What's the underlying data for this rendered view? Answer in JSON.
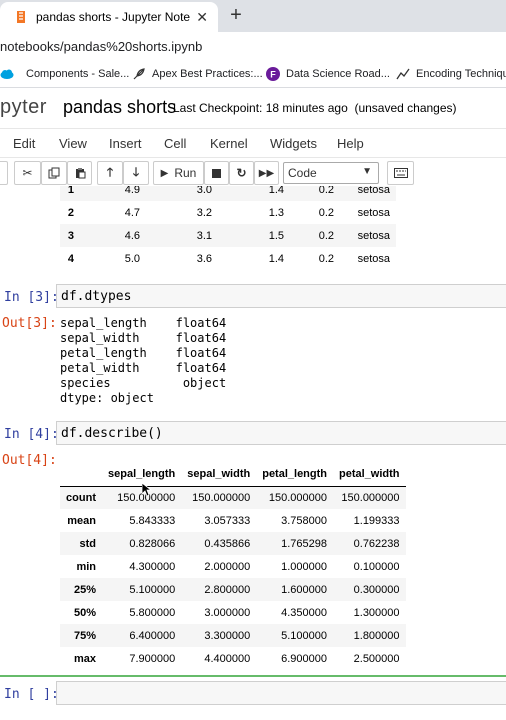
{
  "browser": {
    "tab_title": "pandas shorts - Jupyter Notebook",
    "address": "notebooks/pandas%20shorts.ipynb",
    "bookmarks": [
      {
        "label": "Components - Sale...",
        "icon": "salesforce-cloud-icon",
        "color": "#00a1e0"
      },
      {
        "label": "Apex Best Practices:...",
        "icon": "feather-icon",
        "color": "#333333"
      },
      {
        "label": "Data Science Road...",
        "icon": "circle-f-icon",
        "color": "#6a1b9a"
      },
      {
        "label": "Encoding Technique",
        "icon": "chart-line-icon",
        "color": "#333333"
      }
    ]
  },
  "jupyter": {
    "logo": "pyter",
    "notebook_title": "pandas shorts",
    "checkpoint": "Last Checkpoint: 18 minutes ago",
    "unsaved": "(unsaved changes)",
    "menu": [
      "Edit",
      "View",
      "Insert",
      "Cell",
      "Kernel",
      "Widgets",
      "Help"
    ],
    "toolbar": {
      "run_label": "Run",
      "cell_type": "Code"
    }
  },
  "head_table": {
    "rows": [
      {
        "idx": "1",
        "values": [
          "4.9",
          "3.0",
          "1.4",
          "0.2",
          "setosa"
        ]
      },
      {
        "idx": "2",
        "values": [
          "4.7",
          "3.2",
          "1.3",
          "0.2",
          "setosa"
        ]
      },
      {
        "idx": "3",
        "values": [
          "4.6",
          "3.1",
          "1.5",
          "0.2",
          "setosa"
        ]
      },
      {
        "idx": "4",
        "values": [
          "5.0",
          "3.6",
          "1.4",
          "0.2",
          "setosa"
        ]
      }
    ]
  },
  "cells": {
    "c3": {
      "in_prompt": "In [3]:",
      "code": "df.dtypes",
      "out_prompt": "Out[3]:",
      "output": "sepal_length    float64\nsepal_width     float64\npetal_length    float64\npetal_width     float64\nspecies          object\ndtype: object"
    },
    "c4": {
      "in_prompt": "In [4]:",
      "code": "df.describe()",
      "out_prompt": "Out[4]:"
    },
    "c5": {
      "in_prompt": "In [ ]:",
      "code": ""
    }
  },
  "describe_table": {
    "columns": [
      "sepal_length",
      "sepal_width",
      "petal_length",
      "petal_width"
    ],
    "rows": [
      {
        "stat": "count",
        "values": [
          "150.000000",
          "150.000000",
          "150.000000",
          "150.000000"
        ]
      },
      {
        "stat": "mean",
        "values": [
          "5.843333",
          "3.057333",
          "3.758000",
          "1.199333"
        ]
      },
      {
        "stat": "std",
        "values": [
          "0.828066",
          "0.435866",
          "1.765298",
          "0.762238"
        ]
      },
      {
        "stat": "min",
        "values": [
          "4.300000",
          "2.000000",
          "1.000000",
          "0.100000"
        ]
      },
      {
        "stat": "25%",
        "values": [
          "5.100000",
          "2.800000",
          "1.600000",
          "0.300000"
        ]
      },
      {
        "stat": "50%",
        "values": [
          "5.800000",
          "3.000000",
          "4.350000",
          "1.300000"
        ]
      },
      {
        "stat": "75%",
        "values": [
          "6.400000",
          "3.300000",
          "5.100000",
          "1.800000"
        ]
      },
      {
        "stat": "max",
        "values": [
          "7.900000",
          "4.400000",
          "6.900000",
          "2.500000"
        ]
      }
    ]
  }
}
